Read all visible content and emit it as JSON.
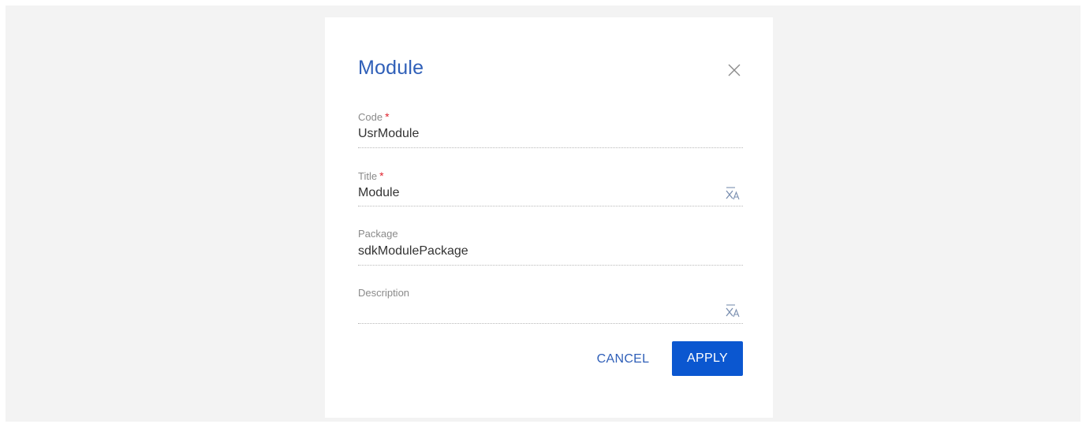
{
  "dialog": {
    "title": "Module",
    "fields": [
      {
        "label": "Code",
        "required_mark": "*",
        "value": "UsrModule"
      },
      {
        "label": "Title",
        "required_mark": "*",
        "value": "Module",
        "icon": "translate-icon"
      },
      {
        "label": "Package",
        "value": "sdkModulePackage"
      },
      {
        "label": "Description",
        "value": "",
        "icon": "translate-icon"
      }
    ],
    "buttons": {
      "cancel": "CANCEL",
      "apply": "APPLY"
    }
  },
  "colors": {
    "accent": "#2f5fb8",
    "apply_button": "#0b57d0",
    "required": "#e0232e",
    "backdrop": "#f3f3f3"
  }
}
